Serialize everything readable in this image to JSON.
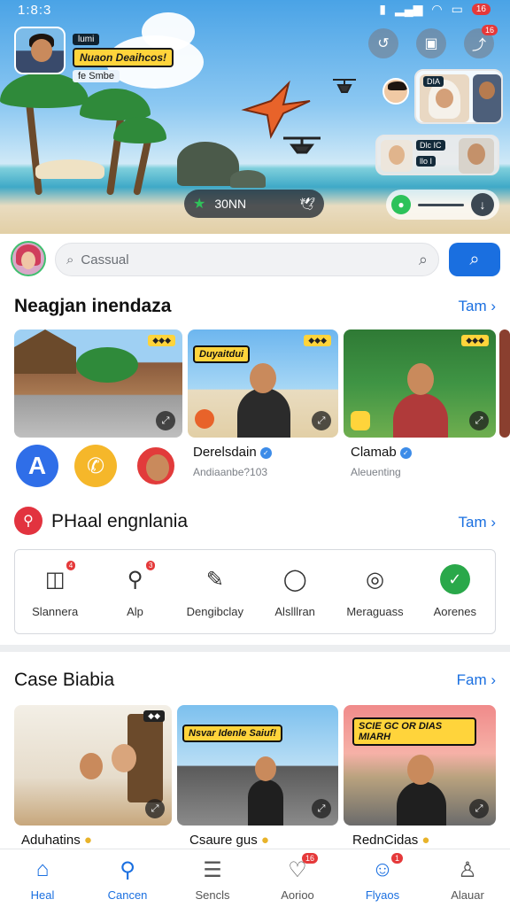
{
  "status_bar": {
    "time": "1:8:3",
    "notification_count": "16"
  },
  "hero": {
    "caption_line1": "lumi",
    "caption_line2": "Nuaon Deaihcos!",
    "caption_line3": "fe Smbe",
    "pill_text": "30NN",
    "live_card1_text": "DIA",
    "live_card2_line1": "Dlc IC",
    "live_card2_line2": "llo I",
    "top_actions": [
      "refresh-icon",
      "square-icon",
      "share-icon"
    ]
  },
  "search": {
    "placeholder": "Cassual"
  },
  "section1": {
    "title": "Neagjan inendaza",
    "link": "Tam",
    "thumb_banner": "Duyaitdui",
    "items": [
      {
        "title": "Derelsdain",
        "subtitle": "Andiaanbe?103"
      },
      {
        "title": "Clamab",
        "subtitle": "Aleuenting"
      }
    ]
  },
  "section2": {
    "title": "PHaal engnlania",
    "link": "Tam",
    "tools": [
      {
        "label": "Slannera",
        "icon": "camera-icon",
        "badge": "4"
      },
      {
        "label": "Alp",
        "icon": "magnifier-icon",
        "badge": "3"
      },
      {
        "label": "Dengibclay",
        "icon": "pen-icon",
        "badge": ""
      },
      {
        "label": "Alslllran",
        "icon": "chat-pin-icon",
        "badge": ""
      },
      {
        "label": "Meraguass",
        "icon": "search-circle-icon",
        "badge": ""
      },
      {
        "label": "Aorenes",
        "icon": "check-circle-icon",
        "badge": ""
      }
    ]
  },
  "section3": {
    "title": "Case Biabia",
    "link": "Fam",
    "banner_mid": "Nsvar Idenle Saiuf!",
    "banner_right": "SCIE GC OR DIAS MIARH",
    "items": [
      {
        "title": "Aduhatins"
      },
      {
        "title": "Csaure gus"
      },
      {
        "title": "RednCidas"
      }
    ]
  },
  "bottom_nav": [
    {
      "label": "Heal",
      "icon": "home-icon",
      "badge": ""
    },
    {
      "label": "Cancen",
      "icon": "search-icon",
      "badge": ""
    },
    {
      "label": "Sencls",
      "icon": "document-icon",
      "badge": ""
    },
    {
      "label": "Aorioo",
      "icon": "heart-icon",
      "badge": "16"
    },
    {
      "label": "Flyaos",
      "icon": "person-icon",
      "badge": "1"
    },
    {
      "label": "Alauar",
      "icon": "profile-icon",
      "badge": ""
    }
  ],
  "colors": {
    "accent": "#1a6fe0",
    "badge": "#e5393a",
    "banner": "#ffd43b"
  }
}
